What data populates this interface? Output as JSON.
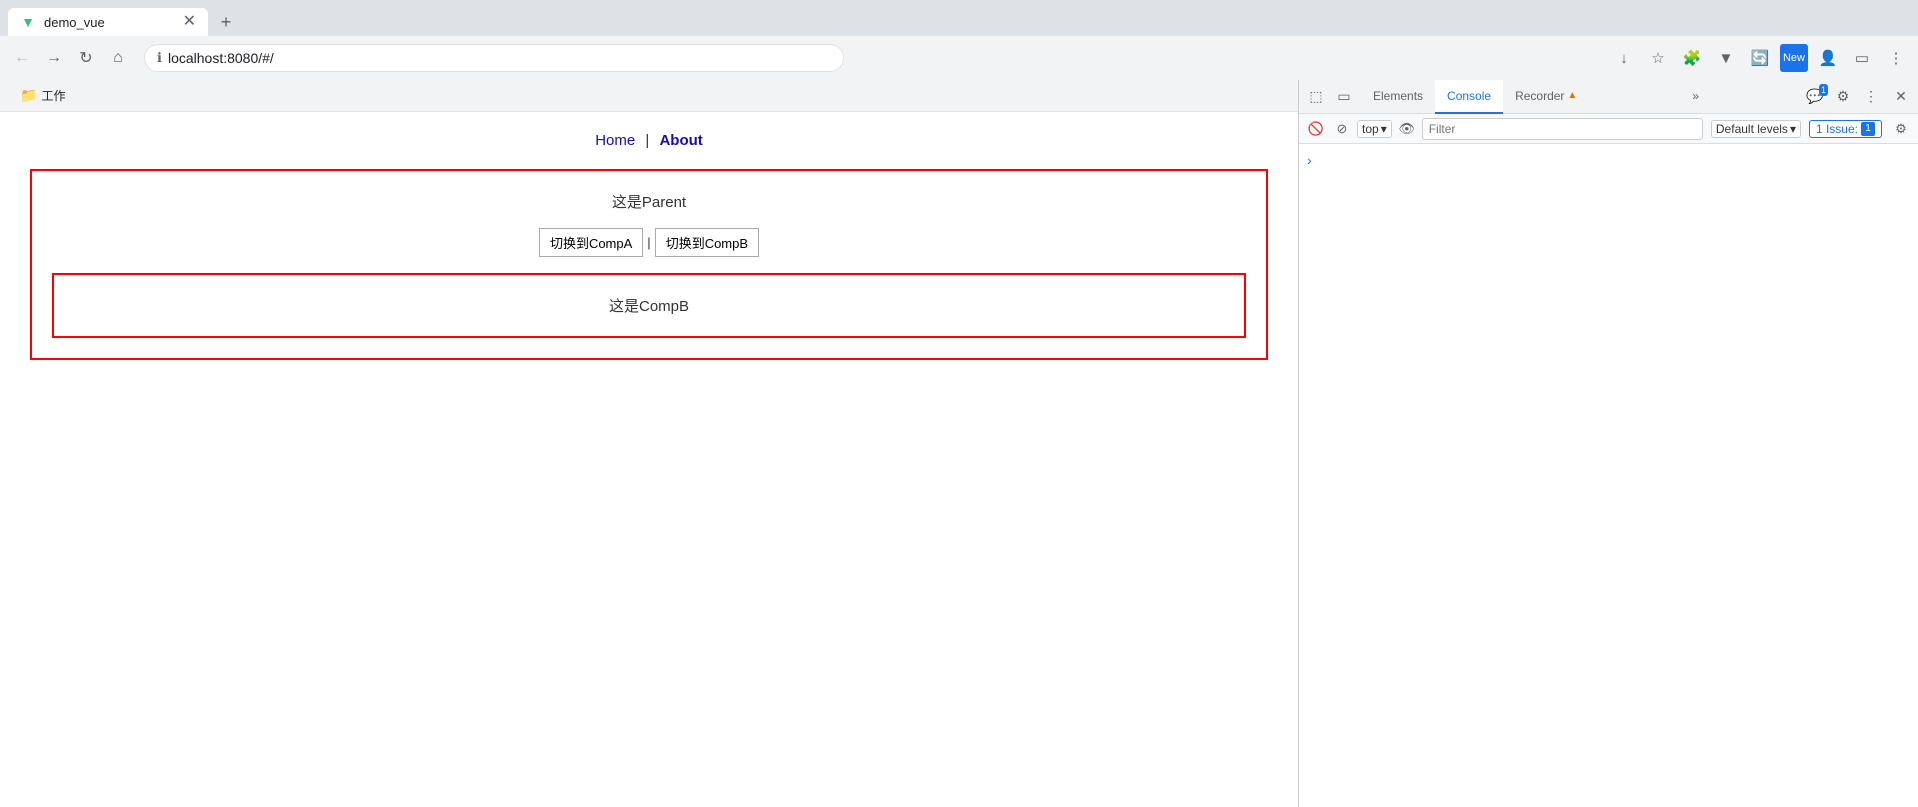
{
  "browser": {
    "tab_title": "demo_vue",
    "url": "localhost:8080/#/",
    "bookmark": "工作",
    "back_label": "←",
    "forward_label": "→",
    "refresh_label": "↻",
    "home_label": "⌂"
  },
  "webpage": {
    "nav": {
      "home_label": "Home",
      "separator": "|",
      "about_label": "About"
    },
    "parent": {
      "title": "这是Parent",
      "btn_a": "切换到CompA",
      "btn_separator": "|",
      "btn_b": "切换到CompB",
      "comp_b_text": "这是CompB"
    }
  },
  "devtools": {
    "tabs": {
      "elements": "Elements",
      "console": "Console",
      "recorder": "Recorder",
      "more": "»"
    },
    "toolbar": {
      "top_label": "top",
      "filter_placeholder": "Filter",
      "default_levels": "Default levels",
      "issues_label": "1 Issue:",
      "issues_count": "1"
    },
    "console_arrow": "›",
    "badge_count": "1"
  }
}
